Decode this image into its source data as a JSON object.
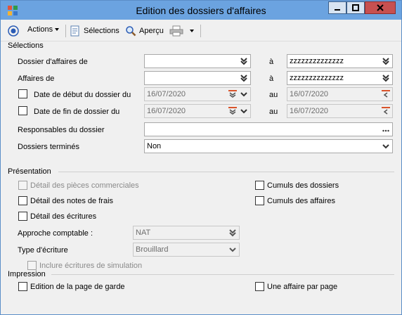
{
  "window": {
    "title": "Edition des dossiers d'affaires",
    "minimize_icon": "minimize-icon",
    "maximize_icon": "maximize-icon",
    "close_icon": "close-icon"
  },
  "toolbar": {
    "actions_label": "Actions",
    "selections_label": "Sélections",
    "apercu_label": "Aperçu"
  },
  "selections": {
    "section_title": "Sélections",
    "dossier_de": {
      "label": "Dossier d'affaires de",
      "from_value": "",
      "to_label": "à",
      "to_value": "zzzzzzzzzzzzzz"
    },
    "affaires_de": {
      "label": "Affaires de",
      "from_value": "",
      "to_label": "à",
      "to_value": "zzzzzzzzzzzzzz"
    },
    "date_debut": {
      "label": "Date de début du dossier du",
      "from_value": "16/07/2020",
      "to_label": "au",
      "to_value": "16/07/2020",
      "checked": false
    },
    "date_fin": {
      "label": "Date de fin de dossier du",
      "from_value": "16/07/2020",
      "to_label": "au",
      "to_value": "16/07/2020",
      "checked": false
    },
    "responsables": {
      "label": "Responsables du dossier",
      "value": ""
    },
    "termines": {
      "label": "Dossiers terminés",
      "value": "Non"
    }
  },
  "presentation": {
    "section_title": "Présentation",
    "detail_pieces": {
      "label": "Détail des pièces commerciales",
      "checked": false,
      "enabled": false
    },
    "detail_notes": {
      "label": "Détail des notes de frais",
      "checked": false,
      "enabled": true
    },
    "detail_ecritures": {
      "label": "Détail des écritures",
      "checked": false,
      "enabled": true
    },
    "cumuls_dossiers": {
      "label": "Cumuls des dossiers",
      "checked": false
    },
    "cumuls_affaires": {
      "label": "Cumuls des affaires",
      "checked": false
    },
    "approche": {
      "label": "Approche comptable :",
      "value": "NAT"
    },
    "type_ecriture": {
      "label": "Type d'écriture",
      "value": "Brouillard"
    },
    "inclure_simulation": {
      "label": "Inclure écritures de simulation",
      "checked": false,
      "enabled": false
    }
  },
  "impression": {
    "section_title": "Impression",
    "page_garde": {
      "label": "Edition de la page de garde",
      "checked": false
    },
    "une_affaire": {
      "label": "Une affaire par page",
      "checked": false
    }
  },
  "colors": {
    "titlebar": "#6ba3e0",
    "window_bg": "#f0f0f0",
    "close_button": "#c75050",
    "calendar_accent": "#d9532b"
  }
}
